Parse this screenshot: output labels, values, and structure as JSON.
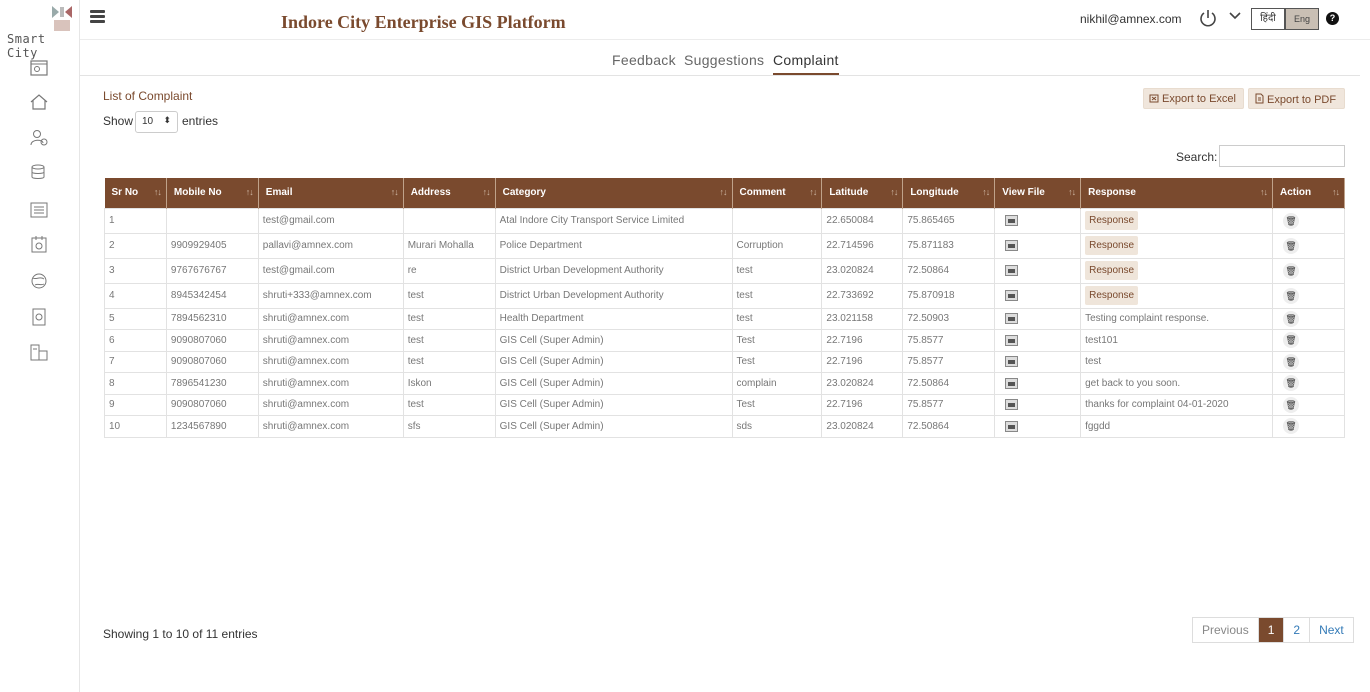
{
  "logo": {
    "text": "Smart City"
  },
  "header": {
    "title": "Indore City Enterprise GIS Platform",
    "user_email": "nikhil@amnex.com",
    "lang_hindi": "हिंदी",
    "lang_english": "Eng",
    "help": "?"
  },
  "tabs": [
    {
      "label": "Feedback"
    },
    {
      "label": "Suggestions"
    },
    {
      "label": "Complaint"
    }
  ],
  "list_title": "List of Complaint",
  "length_menu": {
    "show": "Show",
    "value": "10",
    "entries": "entries"
  },
  "export": {
    "excel": "Export to Excel",
    "pdf": "Export to PDF"
  },
  "search": {
    "label": "Search:"
  },
  "table": {
    "columns": [
      "Sr No",
      "Mobile No",
      "Email",
      "Address",
      "Category",
      "Comment",
      "Latitude",
      "Longitude",
      "View File",
      "Response",
      "Action"
    ],
    "response_label": "Response",
    "rows": [
      {
        "sr": "1",
        "mobile": "",
        "email": "test@gmail.com",
        "address": "",
        "category": "Atal Indore City Transport Service Limited",
        "comment": "",
        "lat": "22.650084",
        "lng": "75.865465",
        "response": ""
      },
      {
        "sr": "2",
        "mobile": "9909929405",
        "email": "pallavi@amnex.com",
        "address": "Murari Mohalla",
        "category": "Police Department",
        "comment": "Corruption",
        "lat": "22.714596",
        "lng": "75.871183",
        "response": ""
      },
      {
        "sr": "3",
        "mobile": "9767676767",
        "email": "test@gmail.com",
        "address": "re",
        "category": "District Urban Development Authority",
        "comment": "test",
        "lat": "23.020824",
        "lng": "72.50864",
        "response": ""
      },
      {
        "sr": "4",
        "mobile": "8945342454",
        "email": "shruti+333@amnex.com",
        "address": "test",
        "category": "District Urban Development Authority",
        "comment": "test",
        "lat": "22.733692",
        "lng": "75.870918",
        "response": ""
      },
      {
        "sr": "5",
        "mobile": "7894562310",
        "email": "shruti@amnex.com",
        "address": "test",
        "category": "Health Department",
        "comment": "test",
        "lat": "23.021158",
        "lng": "72.50903",
        "response": "Testing complaint response."
      },
      {
        "sr": "6",
        "mobile": "9090807060",
        "email": "shruti@amnex.com",
        "address": "test",
        "category": "GIS Cell (Super Admin)",
        "comment": "Test",
        "lat": "22.7196",
        "lng": "75.8577",
        "response": "test101"
      },
      {
        "sr": "7",
        "mobile": "9090807060",
        "email": "shruti@amnex.com",
        "address": "test",
        "category": "GIS Cell (Super Admin)",
        "comment": "Test",
        "lat": "22.7196",
        "lng": "75.8577",
        "response": "test"
      },
      {
        "sr": "8",
        "mobile": "7896541230",
        "email": "shruti@amnex.com",
        "address": "Iskon",
        "category": "GIS Cell (Super Admin)",
        "comment": "complain",
        "lat": "23.020824",
        "lng": "72.50864",
        "response": "get back to you soon."
      },
      {
        "sr": "9",
        "mobile": "9090807060",
        "email": "shruti@amnex.com",
        "address": "test",
        "category": "GIS Cell (Super Admin)",
        "comment": "Test",
        "lat": "22.7196",
        "lng": "75.8577",
        "response": "thanks for complaint 04-01-2020"
      },
      {
        "sr": "10",
        "mobile": "1234567890",
        "email": "shruti@amnex.com",
        "address": "sfs",
        "category": "GIS Cell (Super Admin)",
        "comment": "sds",
        "lat": "23.020824",
        "lng": "72.50864",
        "response": "fggdd"
      }
    ]
  },
  "footer": {
    "info": "Showing 1 to 10 of 11 entries"
  },
  "pagination": {
    "previous": "Previous",
    "pages": [
      "1",
      "2"
    ],
    "next": "Next"
  },
  "colors": {
    "brand": "#7a4a2e",
    "accent_light": "#f0e6dc"
  }
}
